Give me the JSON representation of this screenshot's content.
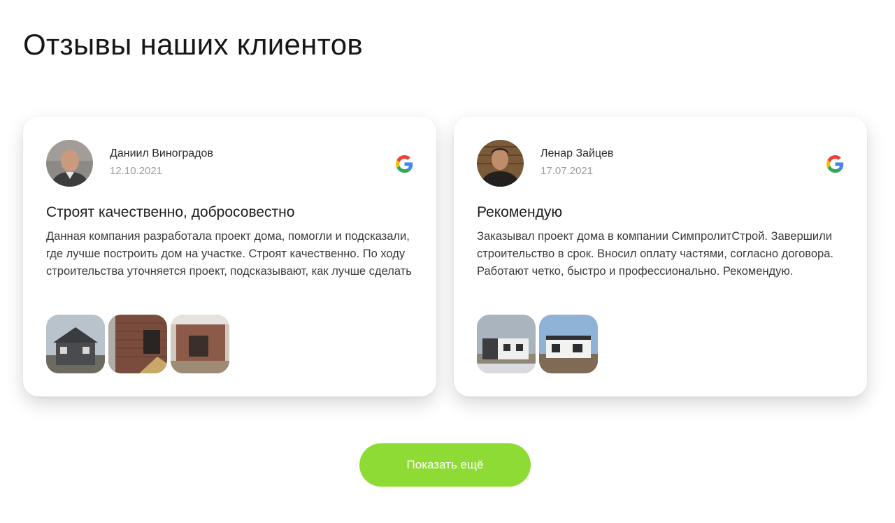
{
  "section": {
    "title": "Отзывы наших клиентов"
  },
  "reviews": [
    {
      "author": "Даниил Виноградов",
      "date": "12.10.2021",
      "title": "Строят качественно, добросовестно",
      "text": "Данная компания разработала проект дома, помогли и подсказали, где лучше построить дом на участке. Строят качественно. По ходу строительства уточняется проект, подсказывают, как лучше сделать",
      "source_icon": "google-icon",
      "photo_count": 3
    },
    {
      "author": "Ленар Зайцев",
      "date": "17.07.2021",
      "title": "Рекомендую",
      "text": "Заказывал проект дома в компании СимпролитСтрой. Завершили строительство в срок. Вносил оплату частями, согласно договора. Работают четко, быстро и профессионально. Рекомендую.",
      "source_icon": "google-icon",
      "photo_count": 2
    }
  ],
  "more_button": {
    "label": "Показать ещё"
  },
  "colors": {
    "accent": "#8edb36",
    "date_text": "#9c9c9c"
  }
}
